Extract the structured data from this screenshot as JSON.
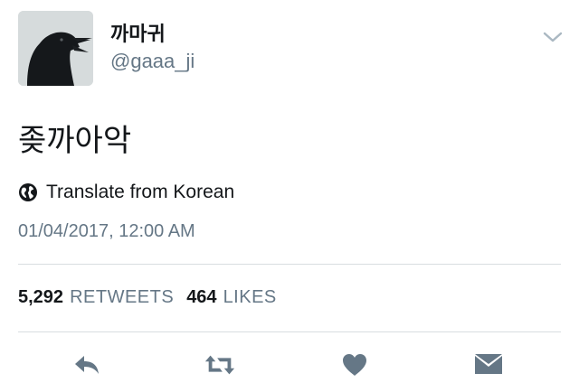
{
  "author": {
    "display_name": "까마귀",
    "handle": "@gaaa_ji",
    "avatar_icon": "crow-avatar"
  },
  "tweet": {
    "text": "좆까아악",
    "translate_label": "Translate from Korean",
    "timestamp": "01/04/2017, 12:00 AM"
  },
  "stats": {
    "retweets_count": "5,292",
    "retweets_label": "RETWEETS",
    "likes_count": "464",
    "likes_label": "LIKES"
  },
  "actions": [
    {
      "icon": "reply-icon"
    },
    {
      "icon": "retweet-icon"
    },
    {
      "icon": "heart-icon"
    },
    {
      "icon": "envelope-icon"
    }
  ],
  "colors": {
    "text_primary": "#14171a",
    "text_secondary": "#657786",
    "icon_gray": "#657786",
    "divider": "#d8dde0"
  }
}
